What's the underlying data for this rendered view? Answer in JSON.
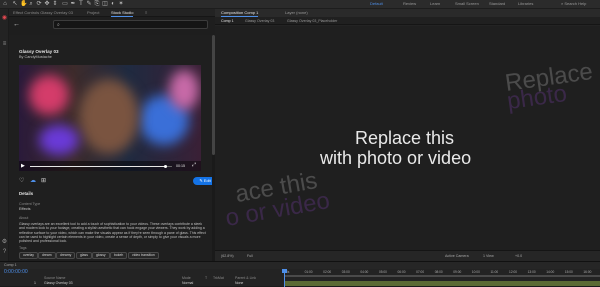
{
  "toolbar": {
    "icons": [
      "home-icon",
      "selection-icon",
      "hand-icon",
      "zoom-icon",
      "orbit-icon",
      "pan-icon",
      "dolly-icon",
      "rectangle-icon",
      "pen-icon",
      "text-icon",
      "brush-icon",
      "clone-icon",
      "eraser-icon",
      "roto-icon",
      "puppet-icon"
    ],
    "workspaces": [
      "Default",
      "Review",
      "Learn",
      "Small Screen",
      "Standard",
      "Libraries"
    ],
    "active_workspace": "Default",
    "search_help": "Search Help"
  },
  "left_panel": {
    "tabs": [
      "Effect Controls Glassy Overlay 03",
      "Project",
      "Stock Studio"
    ],
    "active_tab": "Stock Studio",
    "item": {
      "title": "Glassy Overlay 03",
      "author": "By CandyMustache",
      "time": "00:15",
      "edit_label": "Edit"
    },
    "details": {
      "heading": "Details",
      "content_type_label": "Content Type",
      "content_type": "Effects",
      "about_label": "About",
      "about": "Glassy overlays are an excellent tool to add a touch of sophistication to your videos. These overlays contribute a sleek and modern look to your footage, creating a stylish aesthetic that can hook engage your viewers. They work by adding a reflective surface to your video, which can make the visuals appear as if they're seen through a pane of glass. This effect can be used to highlight certain elements in your video, create a sense of depth, or simply to give your visuals a more polished and professional look.",
      "tags_label": "Tags",
      "tags": [
        "overlay",
        "dream",
        "dreamy",
        "glass",
        "glossy",
        "bokeh",
        "video transition"
      ]
    }
  },
  "right_panel": {
    "tabs": [
      "Composition Comp 1",
      "Layer (none)"
    ],
    "active_tab": "Composition Comp 1",
    "subtabs": [
      "Comp 1",
      "Glassy Overlay 03",
      "Glassy Overlay 03_Placeholder"
    ],
    "active_subtab": "Comp 1",
    "viewer": {
      "line1": "Replace this",
      "line2": "with photo or video"
    },
    "footer": [
      "(62.8%)",
      "Full",
      "Active Camera",
      "1 View",
      "+0.0"
    ]
  },
  "timeline": {
    "comp": "Comp 1",
    "time": "0:00:00:00",
    "columns": [
      "Source Name",
      "Mode",
      "T",
      "TrkMat",
      "Parent & Link"
    ],
    "layer": {
      "index": "1",
      "name": "Glassy Overlay 03",
      "mode": "Normal",
      "parent": "None"
    },
    "ruler": [
      "0s",
      "01:00",
      "02:00",
      "03:00",
      "04:00",
      "05:00",
      "06:00",
      "07:00",
      "08:00",
      "09:00",
      "10:00",
      "11:00",
      "12:00",
      "13:00",
      "14:00",
      "15:00",
      "16:00"
    ]
  }
}
